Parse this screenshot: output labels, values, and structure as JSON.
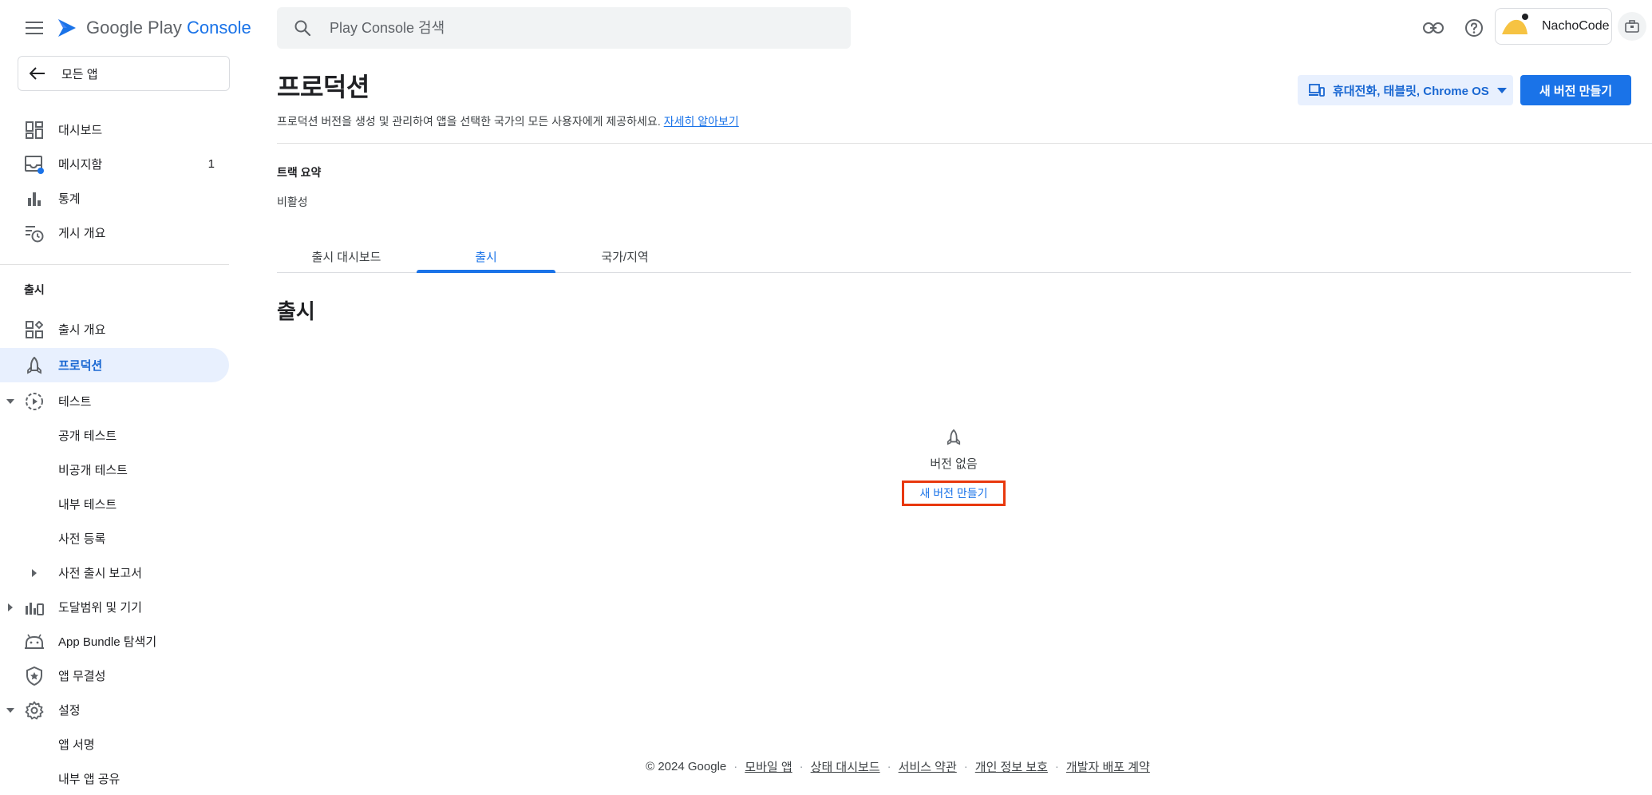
{
  "header": {
    "logo_text_1": "Google Play",
    "logo_text_2": " Console",
    "search_placeholder": "Play Console 검색",
    "account_name": "NachoCode"
  },
  "sidebar": {
    "back_label": "모든 앱",
    "items_top": [
      {
        "label": "대시보드",
        "icon": "dashboard-icon"
      },
      {
        "label": "메시지함",
        "icon": "inbox-icon",
        "count": "1"
      },
      {
        "label": "통계",
        "icon": "bar-chart-icon"
      },
      {
        "label": "게시 개요",
        "icon": "publishing-overview-icon"
      }
    ],
    "section_release": "출시",
    "items_release": [
      {
        "label": "출시 개요",
        "icon": "release-overview-icon"
      },
      {
        "label": "프로덕션",
        "icon": "production-icon",
        "active": true
      },
      {
        "label": "테스트",
        "icon": "testing-icon",
        "expanded": true
      }
    ],
    "testing_sub": [
      "공개 테스트",
      "비공개 테스트",
      "내부 테스트",
      "사전 등록"
    ],
    "prelaunch_report": "사전 출시 보고서",
    "items_more": [
      {
        "label": "도달범위 및 기기",
        "icon": "reach-devices-icon",
        "collapsed": true
      },
      {
        "label": "App Bundle 탐색기",
        "icon": "app-bundle-icon"
      },
      {
        "label": "앱 무결성",
        "icon": "app-integrity-icon"
      },
      {
        "label": "설정",
        "icon": "settings-gear-icon",
        "expanded": true
      }
    ],
    "settings_sub": [
      "앱 서명",
      "내부 앱 공유"
    ]
  },
  "main": {
    "title": "프로덕션",
    "description": "프로덕션 버전을 생성 및 관리하여 앱을 선택한 국가의 모든 사용자에게 제공하세요.",
    "learn_more": "자세히 알아보기",
    "device_filter": "휴대전화, 태블릿, Chrome OS",
    "create_release": "새 버전 만들기",
    "track_summary_label": "트랙 요약",
    "track_summary_value": "비활성",
    "tabs": [
      {
        "label": "출시 대시보드",
        "active": false
      },
      {
        "label": "출시",
        "active": true
      },
      {
        "label": "국가/지역",
        "active": false
      }
    ],
    "section_title": "출시",
    "empty_text": "버전 없음",
    "empty_link": "새 버전 만들기"
  },
  "footer": {
    "copyright": "© 2024 Google",
    "links": [
      "모바일 앱",
      "상태 대시보드",
      "서비스 약관",
      "개인 정보 보호",
      "개발자 배포 계약"
    ]
  },
  "colors": {
    "accent": "#1a73e8",
    "active_bg": "#e8f0fe",
    "highlight_box": "#e8380d"
  }
}
